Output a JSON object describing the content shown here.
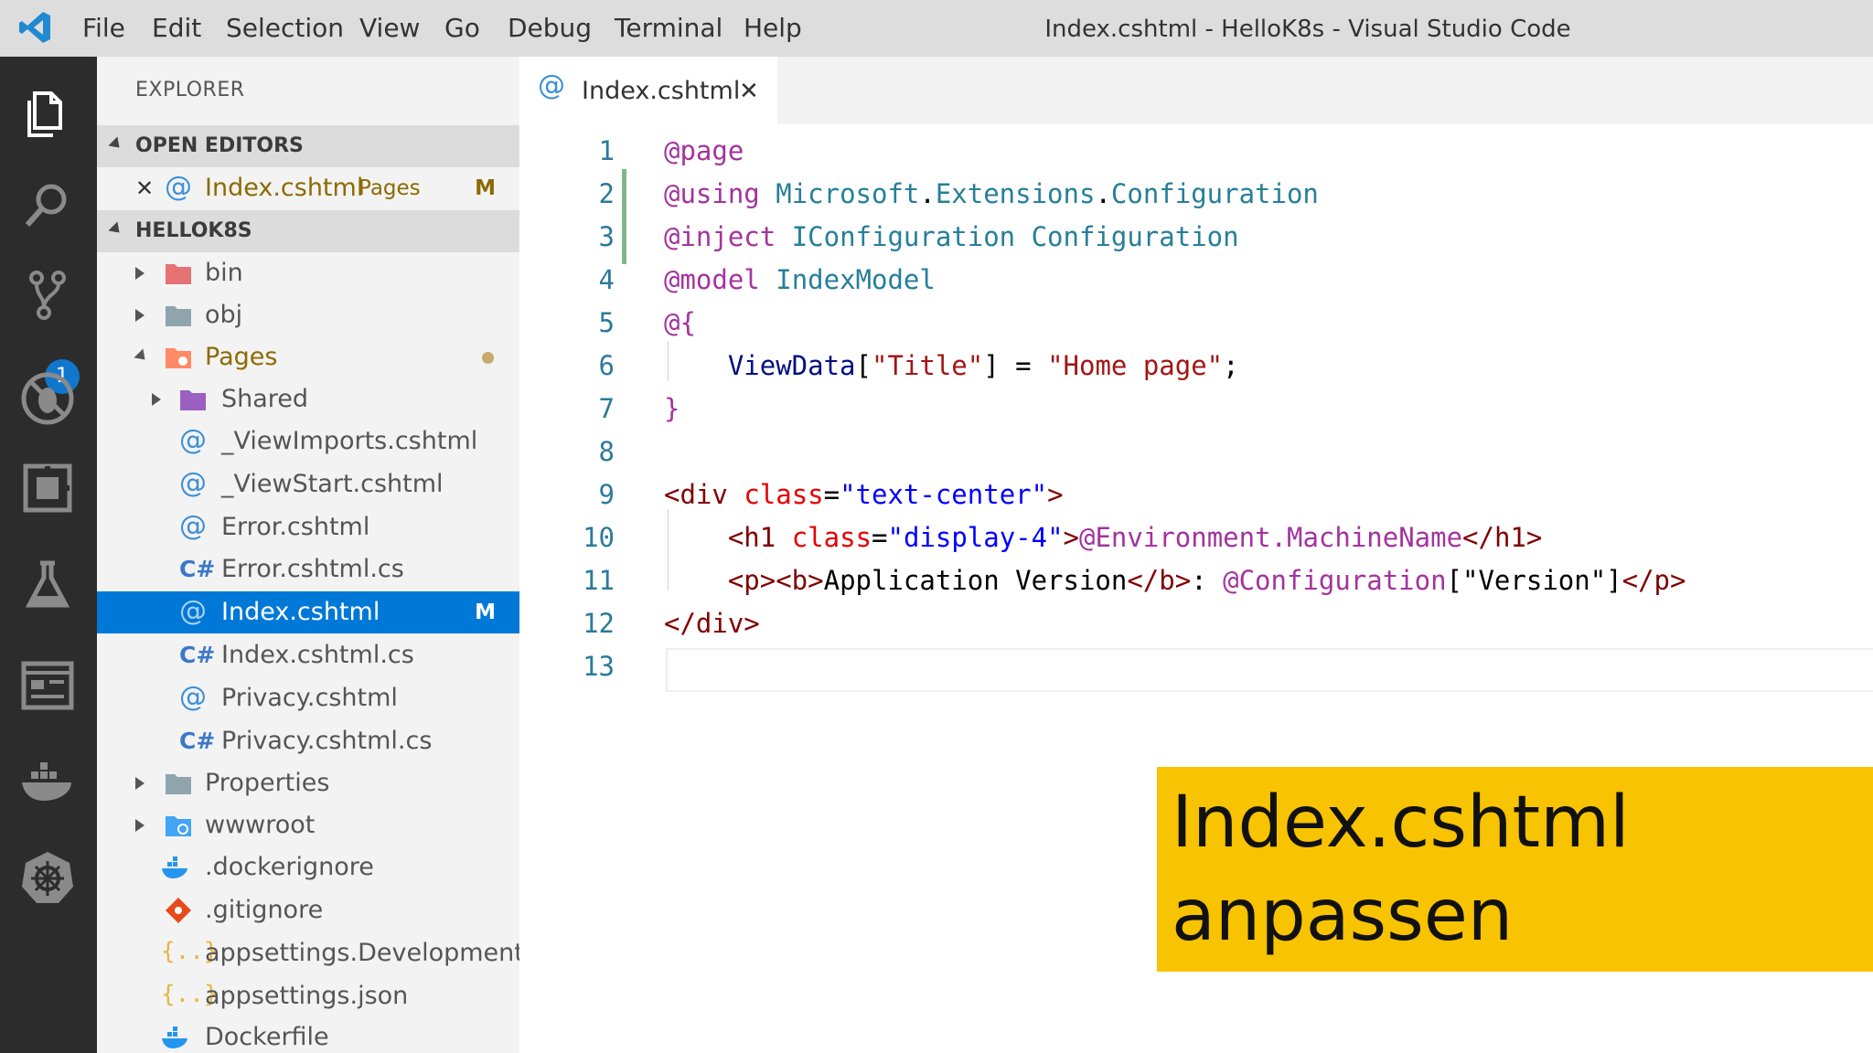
{
  "titlebar": {
    "menu": [
      "File",
      "Edit",
      "Selection",
      "View",
      "Go",
      "Debug",
      "Terminal",
      "Help"
    ],
    "window_title": "Index.cshtml - HelloK8s - Visual Studio Code"
  },
  "activitybar": {
    "icons": [
      "explorer-icon",
      "search-icon",
      "source-control-icon",
      "debug-icon",
      "extensions-icon",
      "test-icon",
      "remote-explorer-icon",
      "docker-icon",
      "kubernetes-icon"
    ],
    "scm_badge": "1"
  },
  "sidebar": {
    "title": "EXPLORER",
    "open_editors_header": "OPEN EDITORS",
    "open_editor": {
      "name": "Index.cshtml",
      "folder": "Pages",
      "status": "M"
    },
    "project_header": "HELLOK8S",
    "items": [
      {
        "name": "bin",
        "type": "folder"
      },
      {
        "name": "obj",
        "type": "folder"
      },
      {
        "name": "Pages",
        "type": "folder"
      },
      {
        "name": "Shared",
        "type": "folder"
      },
      {
        "name": "_ViewImports.cshtml",
        "type": "razor"
      },
      {
        "name": "_ViewStart.cshtml",
        "type": "razor"
      },
      {
        "name": "Error.cshtml",
        "type": "razor"
      },
      {
        "name": "Error.cshtml.cs",
        "type": "csharp"
      },
      {
        "name": "Index.cshtml",
        "type": "razor",
        "status": "M"
      },
      {
        "name": "Index.cshtml.cs",
        "type": "csharp"
      },
      {
        "name": "Privacy.cshtml",
        "type": "razor"
      },
      {
        "name": "Privacy.cshtml.cs",
        "type": "csharp"
      },
      {
        "name": "Properties",
        "type": "folder"
      },
      {
        "name": "wwwroot",
        "type": "folder"
      },
      {
        "name": ".dockerignore",
        "type": "docker"
      },
      {
        "name": ".gitignore",
        "type": "git"
      },
      {
        "name": "appsettings.Development....",
        "type": "json"
      },
      {
        "name": "appsettings.json",
        "type": "json"
      },
      {
        "name": "Dockerfile",
        "type": "docker"
      }
    ]
  },
  "editor": {
    "tab_label": "Index.cshtml",
    "lines": [
      "1",
      "2",
      "3",
      "4",
      "5",
      "6",
      "7",
      "8",
      "9",
      "10",
      "11",
      "12",
      "13"
    ],
    "code": {
      "l1": "@page",
      "l2_dir": "@using",
      "l2_ns": "Microsoft",
      "l2_ns2": "Extensions",
      "l2_ns3": "Configuration",
      "l3_dir": "@inject",
      "l3_type": "IConfiguration",
      "l3_name": "Configuration",
      "l4_dir": "@model",
      "l4_type": "IndexModel",
      "l5": "@{",
      "l6_var": "ViewData",
      "l6_key": "\"Title\"",
      "l6_val": "\"Home page\"",
      "l7": "}",
      "l9_tag": "<div",
      "l9_attr": "class",
      "l9_val": "\"text-center\"",
      "l10_tag": "<h1",
      "l10_attr": "class",
      "l10_val": "\"display-4\"",
      "l10_razor": "@Environment.MachineName",
      "l10_close": "</h1>",
      "l11_tags": "<p><b>",
      "l11_text": "Application Version",
      "l11_tag2": "</b>",
      "l11_razor": "@Configuration",
      "l11_key": "\"Version\"",
      "l11_close": "</p>",
      "l12": "</div>"
    }
  },
  "overlay": {
    "line1": "Index.cshtml",
    "line2": "anpassen",
    "color": "#f8c300"
  }
}
